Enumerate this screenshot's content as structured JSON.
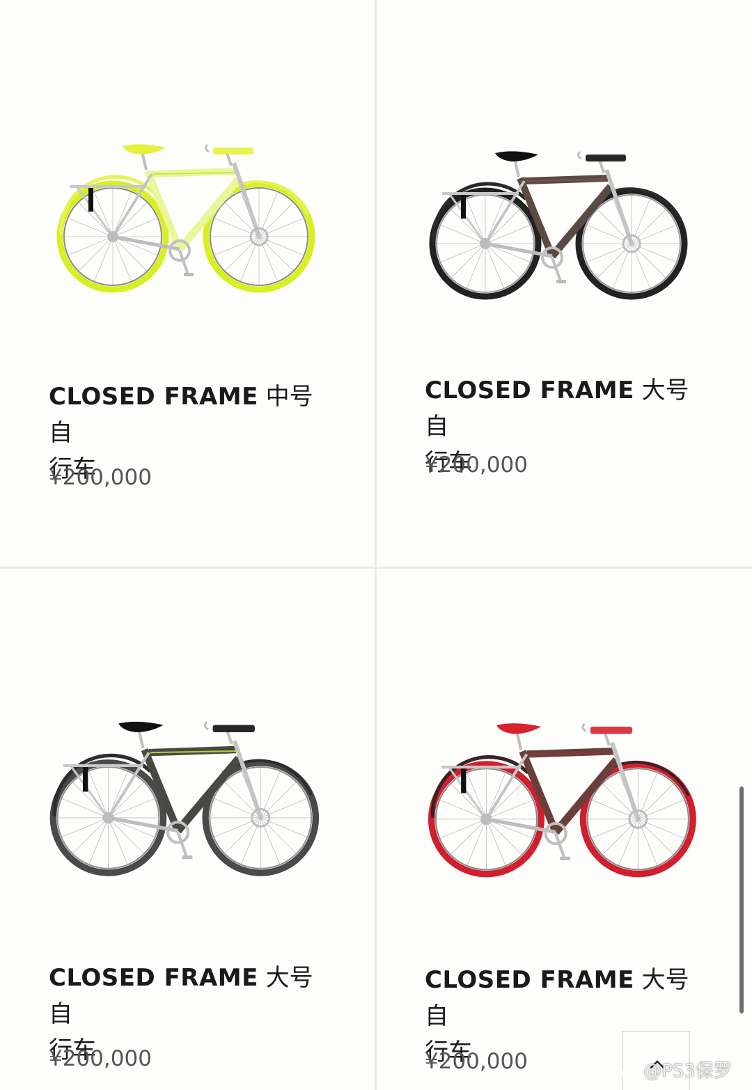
{
  "products": [
    {
      "name_latin": "CLOSED FRAME",
      "name_cn_line1": " 中号自",
      "name_cn_line2": "行车",
      "price": "¥200,000",
      "colors": {
        "frame": "#e9f79a",
        "saddle": "#e5f23c",
        "tire": "#d8f021",
        "tire_inner": "#1a1a1a",
        "fender": "#e3f35a",
        "frame_accent": "#c8dc36"
      }
    },
    {
      "name_latin": "CLOSED FRAME",
      "name_cn_line1": " 大号自",
      "name_cn_line2": "行车",
      "price": "¥200,000",
      "colors": {
        "frame": "#5b4a44",
        "saddle": "#111111",
        "tire": "#222222",
        "tire_inner": "#3a3a3a",
        "fender": "#2a2a2a",
        "frame_accent": "#7a5a4e"
      }
    },
    {
      "name_latin": "CLOSED FRAME",
      "name_cn_line1": " 大号自",
      "name_cn_line2": "行车",
      "price": "¥200,000",
      "colors": {
        "frame": "#4a4845",
        "saddle": "#111111",
        "tire": "#4a4a4a",
        "tire_inner": "#2a2a2a",
        "fender": "#2d2d2d",
        "frame_accent": "#d6ee2c"
      }
    },
    {
      "name_latin": "CLOSED FRAME",
      "name_cn_line1": " 大号自",
      "name_cn_line2": "行车",
      "price": "¥200,000",
      "colors": {
        "frame": "#6a3f3a",
        "saddle": "#d9222e",
        "tire": "#d01f2e",
        "tire_inner": "#1a1a1a",
        "fender": "#3a2222",
        "frame_accent": "#8a3a34"
      }
    }
  ],
  "back_to_top": {
    "icon": "chevron-up-icon"
  },
  "watermark": {
    "text": "@PS3保罗",
    "icon": "weibo-icon"
  }
}
